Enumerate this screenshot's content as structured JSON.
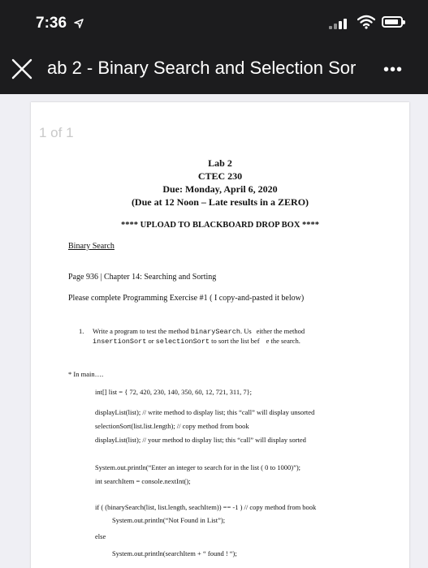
{
  "status_bar": {
    "time": "7:36"
  },
  "nav": {
    "title": "ab 2 - Binary Search and Selection Sor",
    "more": "•••"
  },
  "viewer": {
    "page_count": "1 of 1"
  },
  "document": {
    "title": "Lab 2",
    "course": "CTEC 230",
    "due": "Due: Monday, April 6, 2020",
    "due_note": "(Due at 12 Noon – Late results in a ZERO)",
    "upload": "**** UPLOAD TO BLACKBOARD DROP BOX ****",
    "section_heading": "Binary Search",
    "page_ref": "Page 936  | Chapter 14: Searching and Sorting",
    "instruction": "Please complete Programming Exercise #1  ( I copy-and-pasted it below)",
    "exercise_number": "1.",
    "exercise_line1_a": "Write a program to test the method",
    "exercise_line1_code": "binarySearch",
    "exercise_line1_b": ". Us",
    "exercise_line1_c": "either the method",
    "exercise_line2_code1": "insertionSort",
    "exercise_line2_a": "or",
    "exercise_line2_code2": "selectionSort",
    "exercise_line2_b": "to sort the list bef",
    "exercise_line2_c": "e the search.",
    "in_main": "* In main….",
    "code_lines": [
      "int[] list = { 72, 420, 230, 140, 350, 60, 12, 721, 311, 7};",
      "displayList(list);  // write method to display list;  this “call” will display unsorted",
      "selectionSort(list.list.length);  // copy method from book",
      "displayList(list);  // your method to display list;  this “call” will display sorted",
      "System.out.println(“Enter an integer to search for in the list ( 0 to 1000)”);",
      "int searchItem = console.nextInt();",
      "if ( (binarySearch(list, list.length, seachItem)) == -1 )  // copy method from book",
      "System.out.println(“Not Found in List”);",
      "else",
      "System.out.println(searchItem + “ found ! “);"
    ]
  }
}
